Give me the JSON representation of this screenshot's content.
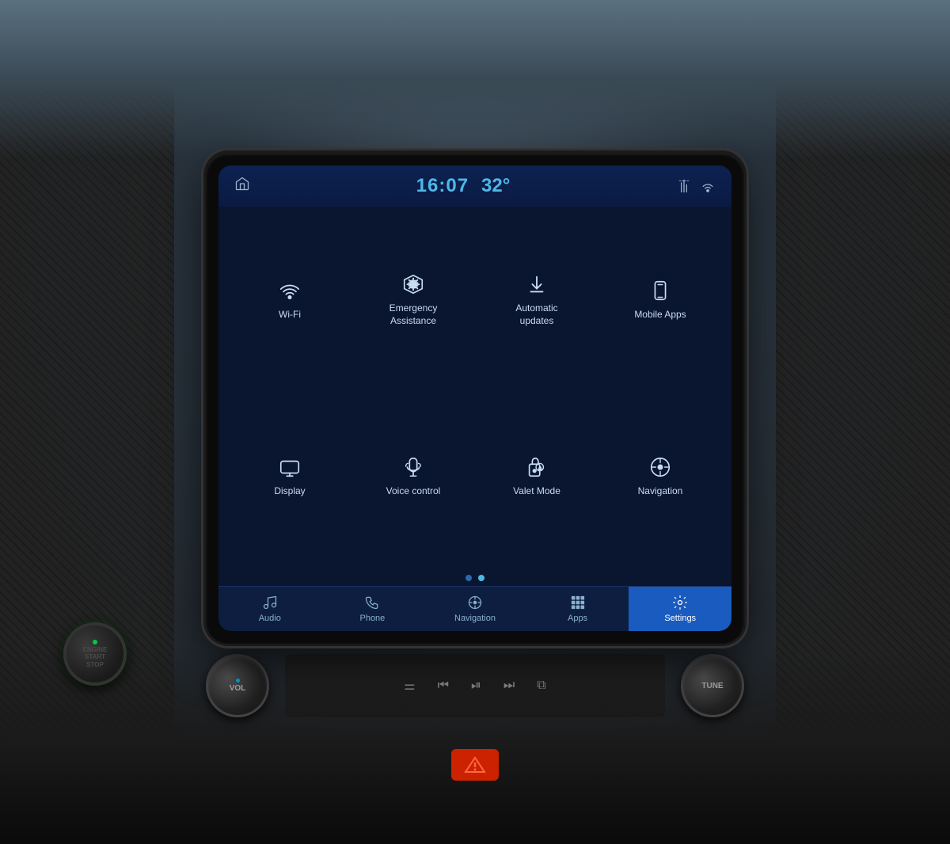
{
  "header": {
    "time": "16:07",
    "temperature": "32°",
    "home_icon": "⌂"
  },
  "grid_items": [
    {
      "id": "wifi",
      "label": "Wi-Fi",
      "icon_type": "wifi"
    },
    {
      "id": "emergency",
      "label": "Emergency\nAssistance",
      "icon_type": "emergency"
    },
    {
      "id": "updates",
      "label": "Automatic\nupdates",
      "icon_type": "updates"
    },
    {
      "id": "mobile-apps",
      "label": "Mobile Apps",
      "icon_type": "mobile"
    },
    {
      "id": "display",
      "label": "Display",
      "icon_type": "display"
    },
    {
      "id": "voice",
      "label": "Voice control",
      "icon_type": "voice"
    },
    {
      "id": "valet",
      "label": "Valet Mode",
      "icon_type": "valet"
    },
    {
      "id": "navigation-grid",
      "label": "Navigation",
      "icon_type": "nav-circle"
    }
  ],
  "nav_items": [
    {
      "id": "audio",
      "label": "Audio",
      "icon_type": "music",
      "active": false
    },
    {
      "id": "phone",
      "label": "Phone",
      "icon_type": "phone",
      "active": false
    },
    {
      "id": "navigation",
      "label": "Navigation",
      "icon_type": "nav",
      "active": false
    },
    {
      "id": "apps",
      "label": "Apps",
      "icon_type": "apps",
      "active": false
    },
    {
      "id": "settings",
      "label": "Settings",
      "icon_type": "settings",
      "active": true
    }
  ],
  "knobs": {
    "vol_label": "VOL",
    "tune_label": "TUNE"
  },
  "engine": {
    "line1": "ENGINE",
    "line2": "START",
    "line3": "STOP"
  },
  "page_dots": {
    "count": 2,
    "active": 1
  }
}
